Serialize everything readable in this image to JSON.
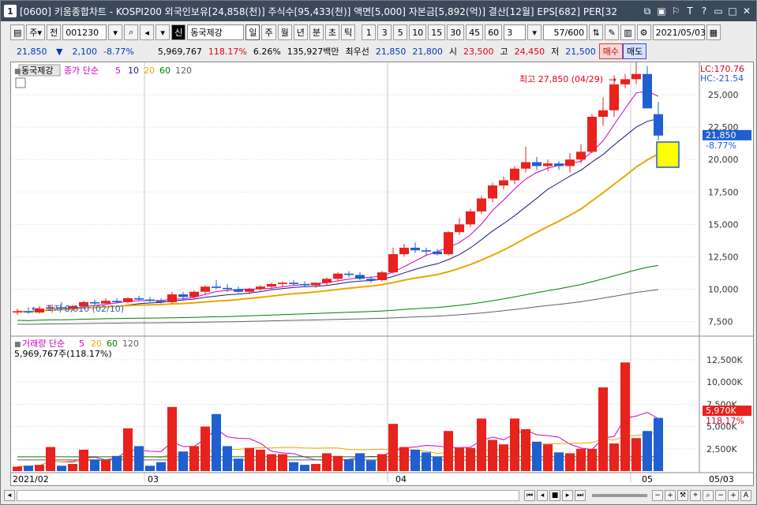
{
  "window": {
    "number": "1",
    "title": "[0600] 키움종합차트 - KOSPI200 외국인보유[24,858(천)] 주식수[95,433(천)] 액면[5,000] 자본금[5,892(억)] 결산[12월] EPS[682] PER[32"
  },
  "toolbar": {
    "period_label": "주",
    "prev_label": "전",
    "code": "001230",
    "market_badge": "신",
    "stock_name": "동국제강",
    "tf": [
      "일",
      "주",
      "월",
      "년",
      "분",
      "초",
      "틱"
    ],
    "nums": [
      "1",
      "3",
      "5",
      "10",
      "15",
      "30",
      "45",
      "60"
    ],
    "interval_value": "3",
    "count": "57/600",
    "date": "2021/05/03"
  },
  "quote": {
    "price": "21,850",
    "arrow": "▼",
    "change": "2,100",
    "change_pct": "-8.77%",
    "volume": "5,969,767",
    "vol_ratio": "118.17%",
    "turnover": "6.26%",
    "amount": "135,927백만",
    "best_label": "최우선",
    "best_ask": "21,850",
    "best_bid": "21,800",
    "open_label": "시",
    "open": "23,500",
    "high_label": "고",
    "high": "24,450",
    "low_label": "저",
    "low": "21,500",
    "buy_label": "매수",
    "sell_label": "매도"
  },
  "price_panel": {
    "name_tag": "동국제강",
    "legend_prefix": "종가 단순",
    "ma_periods": [
      "5",
      "10",
      "20",
      "60",
      "120"
    ],
    "ma_colors": [
      "#d000c0",
      "#1a1a8a",
      "#e8a800",
      "#008000",
      "#606060"
    ],
    "lc": "LC:170.76",
    "hc": "HC:-21.54",
    "high_note": "최고 27,850 (04/29)",
    "low_note": "최저 8,010 (02/10)",
    "current_price": "21,850",
    "current_pct": "-8.77%",
    "y_ticks": [
      "25,000",
      "22,500",
      "20,000",
      "17,500",
      "15,000",
      "12,500",
      "10,000",
      "7,500"
    ]
  },
  "volume_panel": {
    "legend_prefix": "거래량 단순",
    "ma_periods": [
      "5",
      "20",
      "60",
      "120"
    ],
    "current_text": "5,969,767주(118.17%)",
    "current_box": "5,970K",
    "current_pct": "118.17%",
    "y_ticks": [
      "12,500K",
      "10,000K",
      "7,500K",
      "5,000K",
      "2,500K"
    ]
  },
  "x_axis": {
    "labels": [
      "2021/02",
      "03",
      "04",
      "05"
    ],
    "right_label": "05/03"
  },
  "colors": {
    "up": "#e8221c",
    "down": "#1f5fd0",
    "accent_yellow": "#ffff00"
  },
  "chart_data": {
    "type": "candlestick",
    "price_ylim": [
      6500,
      27500
    ],
    "volume_ylim": [
      0,
      14000
    ],
    "candles": [
      {
        "o": 8200,
        "h": 8500,
        "l": 8010,
        "c": 8300,
        "v": 500
      },
      {
        "o": 8300,
        "h": 8600,
        "l": 8100,
        "c": 8200,
        "v": 600
      },
      {
        "o": 8200,
        "h": 8700,
        "l": 8100,
        "c": 8500,
        "v": 700
      },
      {
        "o": 8500,
        "h": 8800,
        "l": 8300,
        "c": 8600,
        "v": 2700
      },
      {
        "o": 8600,
        "h": 9000,
        "l": 8400,
        "c": 8500,
        "v": 600
      },
      {
        "o": 8500,
        "h": 8800,
        "l": 8300,
        "c": 8700,
        "v": 800
      },
      {
        "o": 8700,
        "h": 9100,
        "l": 8500,
        "c": 9000,
        "v": 2400
      },
      {
        "o": 9000,
        "h": 9200,
        "l": 8700,
        "c": 8900,
        "v": 1300
      },
      {
        "o": 8900,
        "h": 9300,
        "l": 8800,
        "c": 9100,
        "v": 1200
      },
      {
        "o": 9100,
        "h": 9300,
        "l": 8900,
        "c": 9000,
        "v": 1700
      },
      {
        "o": 9000,
        "h": 9400,
        "l": 8900,
        "c": 9300,
        "v": 4800
      },
      {
        "o": 9300,
        "h": 9500,
        "l": 9100,
        "c": 9200,
        "v": 2800
      },
      {
        "o": 9200,
        "h": 9400,
        "l": 9000,
        "c": 9100,
        "v": 600
      },
      {
        "o": 9100,
        "h": 9300,
        "l": 8900,
        "c": 9000,
        "v": 1000
      },
      {
        "o": 9000,
        "h": 9800,
        "l": 8900,
        "c": 9600,
        "v": 7200
      },
      {
        "o": 9600,
        "h": 9800,
        "l": 9200,
        "c": 9400,
        "v": 2200
      },
      {
        "o": 9400,
        "h": 9900,
        "l": 9200,
        "c": 9800,
        "v": 2800
      },
      {
        "o": 9800,
        "h": 10300,
        "l": 9600,
        "c": 10200,
        "v": 5000
      },
      {
        "o": 10200,
        "h": 10700,
        "l": 10000,
        "c": 10100,
        "v": 6400
      },
      {
        "o": 10100,
        "h": 10400,
        "l": 9800,
        "c": 10000,
        "v": 2800
      },
      {
        "o": 10000,
        "h": 10200,
        "l": 9700,
        "c": 9800,
        "v": 1400
      },
      {
        "o": 9800,
        "h": 10100,
        "l": 9600,
        "c": 10000,
        "v": 2600
      },
      {
        "o": 10000,
        "h": 10300,
        "l": 9800,
        "c": 10200,
        "v": 2400
      },
      {
        "o": 10200,
        "h": 10500,
        "l": 10000,
        "c": 10400,
        "v": 1900
      },
      {
        "o": 10400,
        "h": 10600,
        "l": 10200,
        "c": 10500,
        "v": 1900
      },
      {
        "o": 10500,
        "h": 10700,
        "l": 10300,
        "c": 10400,
        "v": 1000
      },
      {
        "o": 10400,
        "h": 10600,
        "l": 10200,
        "c": 10300,
        "v": 700
      },
      {
        "o": 10300,
        "h": 10500,
        "l": 10100,
        "c": 10500,
        "v": 800
      },
      {
        "o": 10500,
        "h": 10900,
        "l": 10300,
        "c": 10800,
        "v": 2000
      },
      {
        "o": 10800,
        "h": 11300,
        "l": 10600,
        "c": 11200,
        "v": 1700
      },
      {
        "o": 11200,
        "h": 11400,
        "l": 10900,
        "c": 11100,
        "v": 1300
      },
      {
        "o": 11100,
        "h": 11300,
        "l": 10700,
        "c": 10800,
        "v": 2000
      },
      {
        "o": 10800,
        "h": 11000,
        "l": 10500,
        "c": 10700,
        "v": 1200
      },
      {
        "o": 10700,
        "h": 11400,
        "l": 10600,
        "c": 11300,
        "v": 1900
      },
      {
        "o": 11300,
        "h": 13200,
        "l": 11200,
        "c": 12700,
        "v": 5300
      },
      {
        "o": 12700,
        "h": 13500,
        "l": 12500,
        "c": 13200,
        "v": 2700
      },
      {
        "o": 13200,
        "h": 13600,
        "l": 12800,
        "c": 13000,
        "v": 2400
      },
      {
        "o": 13000,
        "h": 13200,
        "l": 12600,
        "c": 12900,
        "v": 2100
      },
      {
        "o": 12900,
        "h": 13100,
        "l": 12600,
        "c": 12700,
        "v": 1600
      },
      {
        "o": 12700,
        "h": 14500,
        "l": 12600,
        "c": 14400,
        "v": 4500
      },
      {
        "o": 14400,
        "h": 15500,
        "l": 14200,
        "c": 15000,
        "v": 2600
      },
      {
        "o": 15000,
        "h": 16200,
        "l": 14800,
        "c": 16000,
        "v": 2600
      },
      {
        "o": 16000,
        "h": 17200,
        "l": 15800,
        "c": 17000,
        "v": 5900
      },
      {
        "o": 17000,
        "h": 18200,
        "l": 16700,
        "c": 18000,
        "v": 3500
      },
      {
        "o": 18000,
        "h": 18700,
        "l": 17700,
        "c": 18400,
        "v": 3000
      },
      {
        "o": 18400,
        "h": 19500,
        "l": 18100,
        "c": 19300,
        "v": 5900
      },
      {
        "o": 19300,
        "h": 21000,
        "l": 19000,
        "c": 19800,
        "v": 4700
      },
      {
        "o": 19800,
        "h": 20200,
        "l": 19200,
        "c": 19500,
        "v": 3300
      },
      {
        "o": 19500,
        "h": 20000,
        "l": 19100,
        "c": 19700,
        "v": 3000
      },
      {
        "o": 19700,
        "h": 19900,
        "l": 19200,
        "c": 19500,
        "v": 2100
      },
      {
        "o": 19500,
        "h": 20500,
        "l": 19000,
        "c": 20000,
        "v": 2000
      },
      {
        "o": 20000,
        "h": 21200,
        "l": 19700,
        "c": 20600,
        "v": 2500
      },
      {
        "o": 20600,
        "h": 23500,
        "l": 20500,
        "c": 23300,
        "v": 2500
      },
      {
        "o": 23300,
        "h": 24800,
        "l": 22600,
        "c": 23800,
        "v": 9400
      },
      {
        "o": 23800,
        "h": 26500,
        "l": 23300,
        "c": 25800,
        "v": 3100
      },
      {
        "o": 25800,
        "h": 26600,
        "l": 25500,
        "c": 26200,
        "v": 12200
      },
      {
        "o": 26200,
        "h": 27850,
        "l": 25800,
        "c": 26600,
        "v": 3700
      },
      {
        "o": 26600,
        "h": 27200,
        "l": 24500,
        "c": 23950,
        "v": 4500
      },
      {
        "o": 23500,
        "h": 24450,
        "l": 21500,
        "c": 21850,
        "v": 5970
      }
    ]
  }
}
